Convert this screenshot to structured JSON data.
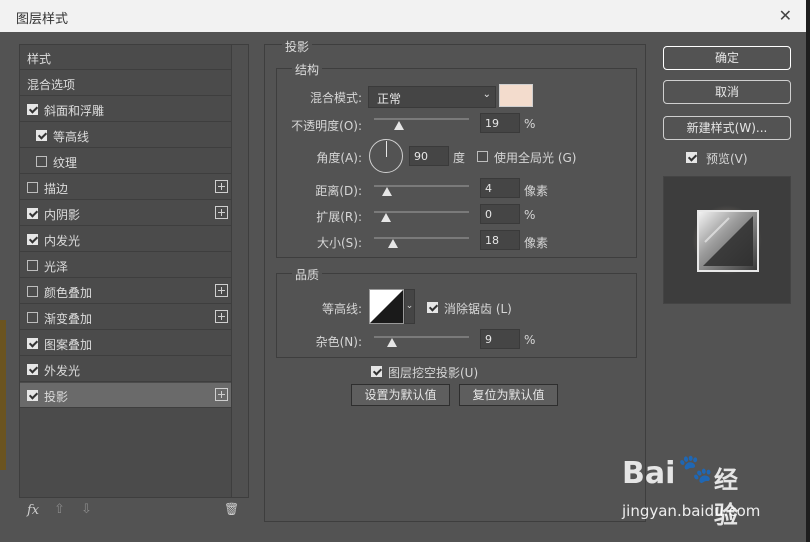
{
  "window": {
    "title": "图层样式",
    "close_glyph": "✕"
  },
  "styles_list": {
    "items": [
      {
        "label": "样式",
        "has_checkbox": false,
        "checked": false,
        "has_plus": false,
        "selected": false,
        "indent": 0
      },
      {
        "label": "混合选项",
        "has_checkbox": false,
        "checked": false,
        "has_plus": false,
        "selected": false,
        "indent": 0
      },
      {
        "label": "斜面和浮雕",
        "has_checkbox": true,
        "checked": true,
        "has_plus": false,
        "selected": false,
        "indent": 0
      },
      {
        "label": "等高线",
        "has_checkbox": true,
        "checked": true,
        "has_plus": false,
        "selected": false,
        "indent": 1
      },
      {
        "label": "纹理",
        "has_checkbox": true,
        "checked": false,
        "has_plus": false,
        "selected": false,
        "indent": 1
      },
      {
        "label": "描边",
        "has_checkbox": true,
        "checked": false,
        "has_plus": true,
        "selected": false,
        "indent": 0
      },
      {
        "label": "内阴影",
        "has_checkbox": true,
        "checked": true,
        "has_plus": true,
        "selected": false,
        "indent": 0
      },
      {
        "label": "内发光",
        "has_checkbox": true,
        "checked": true,
        "has_plus": false,
        "selected": false,
        "indent": 0
      },
      {
        "label": "光泽",
        "has_checkbox": true,
        "checked": false,
        "has_plus": false,
        "selected": false,
        "indent": 0
      },
      {
        "label": "颜色叠加",
        "has_checkbox": true,
        "checked": false,
        "has_plus": true,
        "selected": false,
        "indent": 0
      },
      {
        "label": "渐变叠加",
        "has_checkbox": true,
        "checked": false,
        "has_plus": true,
        "selected": false,
        "indent": 0
      },
      {
        "label": "图案叠加",
        "has_checkbox": true,
        "checked": true,
        "has_plus": false,
        "selected": false,
        "indent": 0
      },
      {
        "label": "外发光",
        "has_checkbox": true,
        "checked": true,
        "has_plus": false,
        "selected": false,
        "indent": 0
      },
      {
        "label": "投影",
        "has_checkbox": true,
        "checked": true,
        "has_plus": true,
        "selected": true,
        "indent": 0
      }
    ],
    "bottom_tools": {
      "fx": "fx",
      "up": "⇧",
      "down": "⇩",
      "trash": "🗑"
    }
  },
  "drop_shadow": {
    "section_title": "投影",
    "structure": {
      "title": "结构",
      "blend_mode": {
        "label": "混合模式:",
        "value": "正常"
      },
      "shadow_color": "#f3dccd",
      "opacity": {
        "label": "不透明度(O):",
        "value": "19",
        "unit": "%",
        "slider": 0.19
      },
      "angle": {
        "label": "角度(A):",
        "value": "90",
        "unit": "度",
        "degrees": 90
      },
      "global_light": {
        "label": "使用全局光 (G)",
        "checked": false
      },
      "distance": {
        "label": "距离(D):",
        "value": "4",
        "unit": "像素",
        "slider": 0.02
      },
      "spread": {
        "label": "扩展(R):",
        "value": "0",
        "unit": "%",
        "slider": 0.0
      },
      "size": {
        "label": "大小(S):",
        "value": "18",
        "unit": "像素",
        "slider": 0.1
      }
    },
    "quality": {
      "title": "品质",
      "contour": {
        "label": "等高线:"
      },
      "anti_alias": {
        "label": "消除锯齿 (L)",
        "checked": true
      },
      "noise": {
        "label": "杂色(N):",
        "value": "9",
        "unit": "%",
        "slider": 0.09
      }
    },
    "knockout": {
      "label": "图层挖空投影(U)",
      "checked": true
    },
    "make_default_label": "设置为默认值",
    "reset_default_label": "复位为默认值"
  },
  "actions": {
    "ok_label": "确定",
    "cancel_label": "取消",
    "new_style_label": "新建样式(W)...",
    "preview": {
      "label": "预览(V)",
      "checked": true
    }
  },
  "watermark": {
    "brand": "Bai",
    "brand_cn": "经验",
    "url": "jingyan.baidu.com"
  },
  "colors": {
    "accent_selected": "#6a6a6a",
    "panel": "#535353"
  }
}
